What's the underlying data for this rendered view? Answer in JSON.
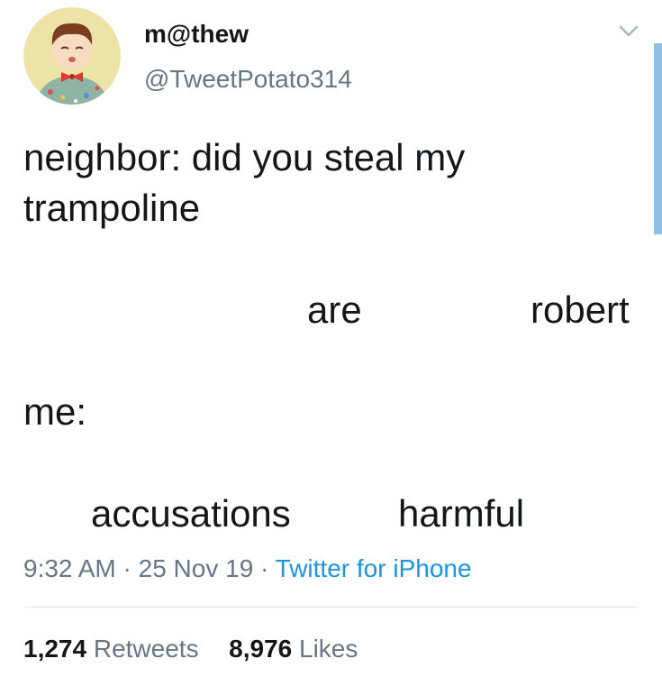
{
  "author": {
    "display_name": "m@thew",
    "handle": "@TweetPotato314",
    "avatar_icon": "cartoon-baby-avatar"
  },
  "tweet": {
    "line1": "neighbor: did you steal my",
    "line2": "trampoline",
    "word_are": "are",
    "word_robert": "robert",
    "word_me": "me:",
    "word_accusations": "accusations",
    "word_harmful": "harmful"
  },
  "meta": {
    "time": "9:32 AM",
    "separator": "·",
    "date": "25 Nov 19",
    "source": "Twitter for iPhone"
  },
  "stats": {
    "retweets_count": "1,274",
    "retweets_label": "Retweets",
    "likes_count": "8,976",
    "likes_label": "Likes"
  },
  "colors": {
    "text": "#14171a",
    "secondary": "#657786",
    "link": "#1b95e0",
    "divider": "#e1e8ed"
  }
}
